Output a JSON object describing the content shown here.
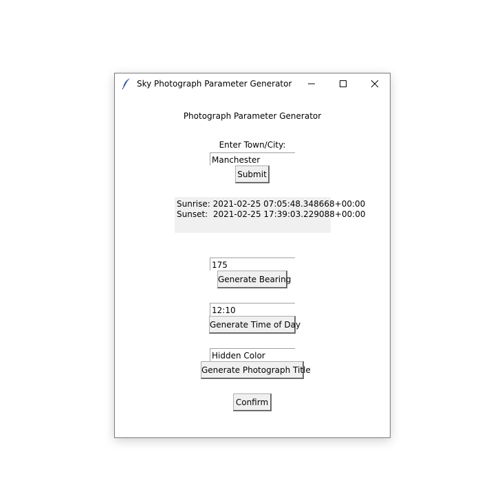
{
  "window": {
    "title": "Sky Photograph Parameter Generator"
  },
  "main": {
    "heading": "Photograph Parameter Generator",
    "city_label": "Enter Town/City:",
    "city_value": "Manchester",
    "submit_label": "Submit",
    "sunrise_text": "Sunrise: 2021-02-25 07:05:48.348668+00:00",
    "sunset_text": "Sunset:  2021-02-25 17:39:03.229088+00:00",
    "bearing_value": "175",
    "bearing_button": "Generate Bearing",
    "time_value": "12:10",
    "time_button": "Generate Time of Day",
    "title_value": "Hidden Color",
    "title_button": "Generate Photograph Title",
    "confirm_label": "Confirm"
  },
  "icons": {
    "app": "feather-icon",
    "minimize": "minimize-icon",
    "maximize": "maximize-icon",
    "close": "close-icon"
  }
}
